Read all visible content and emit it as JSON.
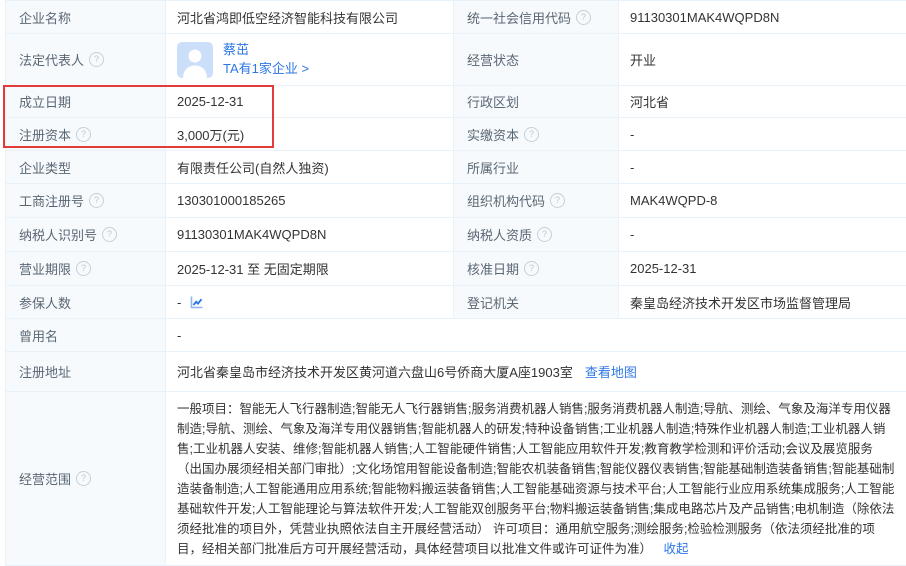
{
  "colors": {
    "accent_blue": "#2d77e5",
    "accent_orange": "#ff8d1a",
    "highlight_red": "#e23b3b",
    "label_bg": "#f7fafd",
    "border": "#e9f1f9"
  },
  "icons": {
    "help": "?",
    "chevron_right": ">"
  },
  "fields": {
    "company_name": {
      "label": "企业名称",
      "value": "河北省鸿即低空经济智能科技有限公司"
    },
    "credit_code": {
      "label": "统一社会信用代码",
      "value": "91130301MAK4WQPD8N"
    },
    "legal_rep": {
      "label": "法定代表人",
      "name": "蔡茁",
      "companies_link": "TA有1家企业 >"
    },
    "status": {
      "label": "经营状态",
      "value": "开业"
    },
    "establish_date": {
      "label": "成立日期",
      "value": "2025-12-31"
    },
    "admin_division": {
      "label": "行政区划",
      "value": "河北省"
    },
    "reg_capital": {
      "label": "注册资本",
      "value": "3,000万(元)"
    },
    "paid_capital": {
      "label": "实缴资本",
      "value": "-"
    },
    "company_type": {
      "label": "企业类型",
      "value": "有限责任公司(自然人独资)"
    },
    "industry": {
      "label": "所属行业",
      "value": "-"
    },
    "reg_number": {
      "label": "工商注册号",
      "value": "130301000185265"
    },
    "org_code": {
      "label": "组织机构代码",
      "value": "MAK4WQPD-8"
    },
    "taxpayer_id": {
      "label": "纳税人识别号",
      "value": "91130301MAK4WQPD8N"
    },
    "taxpayer_qualification": {
      "label": "纳税人资质",
      "value": "-"
    },
    "business_term": {
      "label": "营业期限",
      "value": "2025-12-31 至 无固定期限"
    },
    "approval_date": {
      "label": "核准日期",
      "value": "2025-12-31"
    },
    "insured_count": {
      "label": "参保人数",
      "value": "-"
    },
    "registration_authority": {
      "label": "登记机关",
      "value": "秦皇岛经济技术开发区市场监督管理局"
    },
    "former_name": {
      "label": "曾用名",
      "value": "-"
    },
    "reg_address": {
      "label": "注册地址",
      "value": "河北省秦皇岛市经济技术开发区黄河道六盘山6号侨商大厦A座1903室",
      "map_link": "查看地图"
    },
    "business_scope": {
      "label": "经营范围",
      "value": "一般项目：智能无人飞行器制造;智能无人飞行器销售;服务消费机器人销售;服务消费机器人制造;导航、测绘、气象及海洋专用仪器制造;导航、测绘、气象及海洋专用仪器销售;智能机器人的研发;特种设备销售;工业机器人制造;特殊作业机器人制造;工业机器人销售;工业机器人安装、维修;智能机器人销售;人工智能硬件销售;人工智能应用软件开发;教育教学检测和评价活动;会议及展览服务（出国办展须经相关部门审批）;文化场馆用智能设备制造;智能农机装备销售;智能仪器仪表销售;智能基础制造装备销售;智能基础制造装备制造;人工智能通用应用系统;智能物料搬运装备销售;人工智能基础资源与技术平台;人工智能行业应用系统集成服务;人工智能基础软件开发;人工智能理论与算法软件开发;人工智能双创服务平台;物料搬运装备销售;集成电路芯片及产品销售;电机制造（除依法须经批准的项目外，凭营业执照依法自主开展经营活动） 许可项目：通用航空服务;测绘服务;检验检测服务（依法须经批准的项目，经相关部门批准后方可开展经营活动，具体经营项目以批准文件或许可证件为准）",
      "collapse_link": "收起"
    }
  }
}
